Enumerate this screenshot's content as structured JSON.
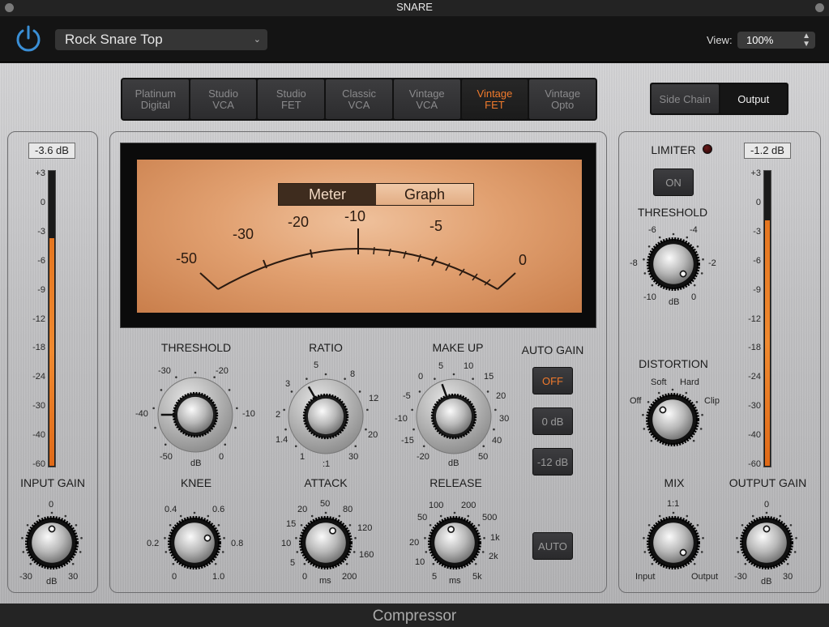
{
  "window": {
    "title": "SNARE"
  },
  "header": {
    "preset": "Rock Snare Top",
    "view_label": "View:",
    "view_value": "100%"
  },
  "models": [
    {
      "label": "Platinum\nDigital"
    },
    {
      "label": "Studio\nVCA"
    },
    {
      "label": "Studio\nFET"
    },
    {
      "label": "Classic\nVCA"
    },
    {
      "label": "Vintage\nVCA"
    },
    {
      "label": "Vintage\nFET",
      "active": true
    },
    {
      "label": "Vintage\nOpto"
    }
  ],
  "routing": {
    "side_chain": "Side Chain",
    "output": "Output"
  },
  "input": {
    "readout": "-3.6 dB",
    "label": "INPUT GAIN",
    "scale": [
      "+3",
      "0",
      "-3",
      "-6",
      "-9",
      "-12",
      "-18",
      "-24",
      "-30",
      "-40",
      "-60"
    ],
    "level_fraction": 0.77,
    "knob_min": "-30",
    "knob_mid": "0",
    "knob_max": "30",
    "knob_unit": "dB"
  },
  "output": {
    "readout": "-1.2 dB",
    "label": "OUTPUT GAIN",
    "scale": [
      "+3",
      "0",
      "-3",
      "-6",
      "-9",
      "-12",
      "-18",
      "-24",
      "-30",
      "-40",
      "-60"
    ],
    "level_fraction": 0.83,
    "knob_min": "-30",
    "knob_mid": "0",
    "knob_max": "30",
    "knob_unit": "dB"
  },
  "meter": {
    "meter_tab": "Meter",
    "graph_tab": "Graph",
    "scale": [
      "-50",
      "-30",
      "-20",
      "-10",
      "-5",
      "0"
    ]
  },
  "threshold": {
    "label": "THRESHOLD",
    "ticks": {
      "a": "-30",
      "b": "-20",
      "c": "-40",
      "d": "-10",
      "e": "-50",
      "f": "0",
      "unit": "dB"
    }
  },
  "ratio": {
    "label": "RATIO",
    "ticks": {
      "a": "5",
      "b": "8",
      "c": "3",
      "d": "12",
      "e": "2",
      "f": "20",
      "g": "1.4",
      "h": "30",
      "i": "1",
      "unit": ":1"
    }
  },
  "makeup": {
    "label": "MAKE UP",
    "ticks": {
      "a": "5",
      "b": "10",
      "c": "0",
      "d": "15",
      "e": "-5",
      "f": "20",
      "g": "-10",
      "h": "30",
      "i": "-15",
      "j": "40",
      "k": "-20",
      "l": "50",
      "unit": "dB"
    }
  },
  "autogain": {
    "label": "AUTO GAIN",
    "off": "OFF",
    "zero": "0 dB",
    "minus12": "-12 dB"
  },
  "knee": {
    "label": "KNEE",
    "ticks": {
      "a": "0.4",
      "b": "0.6",
      "c": "0.2",
      "d": "0.8",
      "e": "0",
      "f": "1.0"
    }
  },
  "attack": {
    "label": "ATTACK",
    "ticks": {
      "a": "50",
      "b": "20",
      "c": "80",
      "d": "15",
      "e": "120",
      "f": "10",
      "g": "160",
      "h": "5",
      "i": "0",
      "j": "200",
      "unit": "ms"
    }
  },
  "release": {
    "label": "RELEASE",
    "ticks": {
      "a": "100",
      "b": "200",
      "c": "50",
      "d": "500",
      "e": "1k",
      "f": "20",
      "g": "2k",
      "h": "10",
      "i": "5",
      "j": "5k",
      "unit": "ms"
    }
  },
  "auto_button": "AUTO",
  "limiter": {
    "label": "LIMITER",
    "on": "ON",
    "threshold_label": "THRESHOLD",
    "ticks": {
      "a": "-6",
      "b": "-4",
      "c": "-8",
      "d": "-2",
      "e": "-10",
      "f": "0",
      "unit": "dB"
    }
  },
  "distortion": {
    "label": "DISTORTION",
    "soft": "Soft",
    "hard": "Hard",
    "off": "Off",
    "clip": "Clip"
  },
  "mix": {
    "label": "MIX",
    "top": "1:1",
    "left": "Input",
    "right": "Output"
  },
  "footer": {
    "title": "Compressor"
  },
  "colors": {
    "accent": "#f07a2c",
    "meter": "#e87a22",
    "power": "#3a8fd6"
  }
}
